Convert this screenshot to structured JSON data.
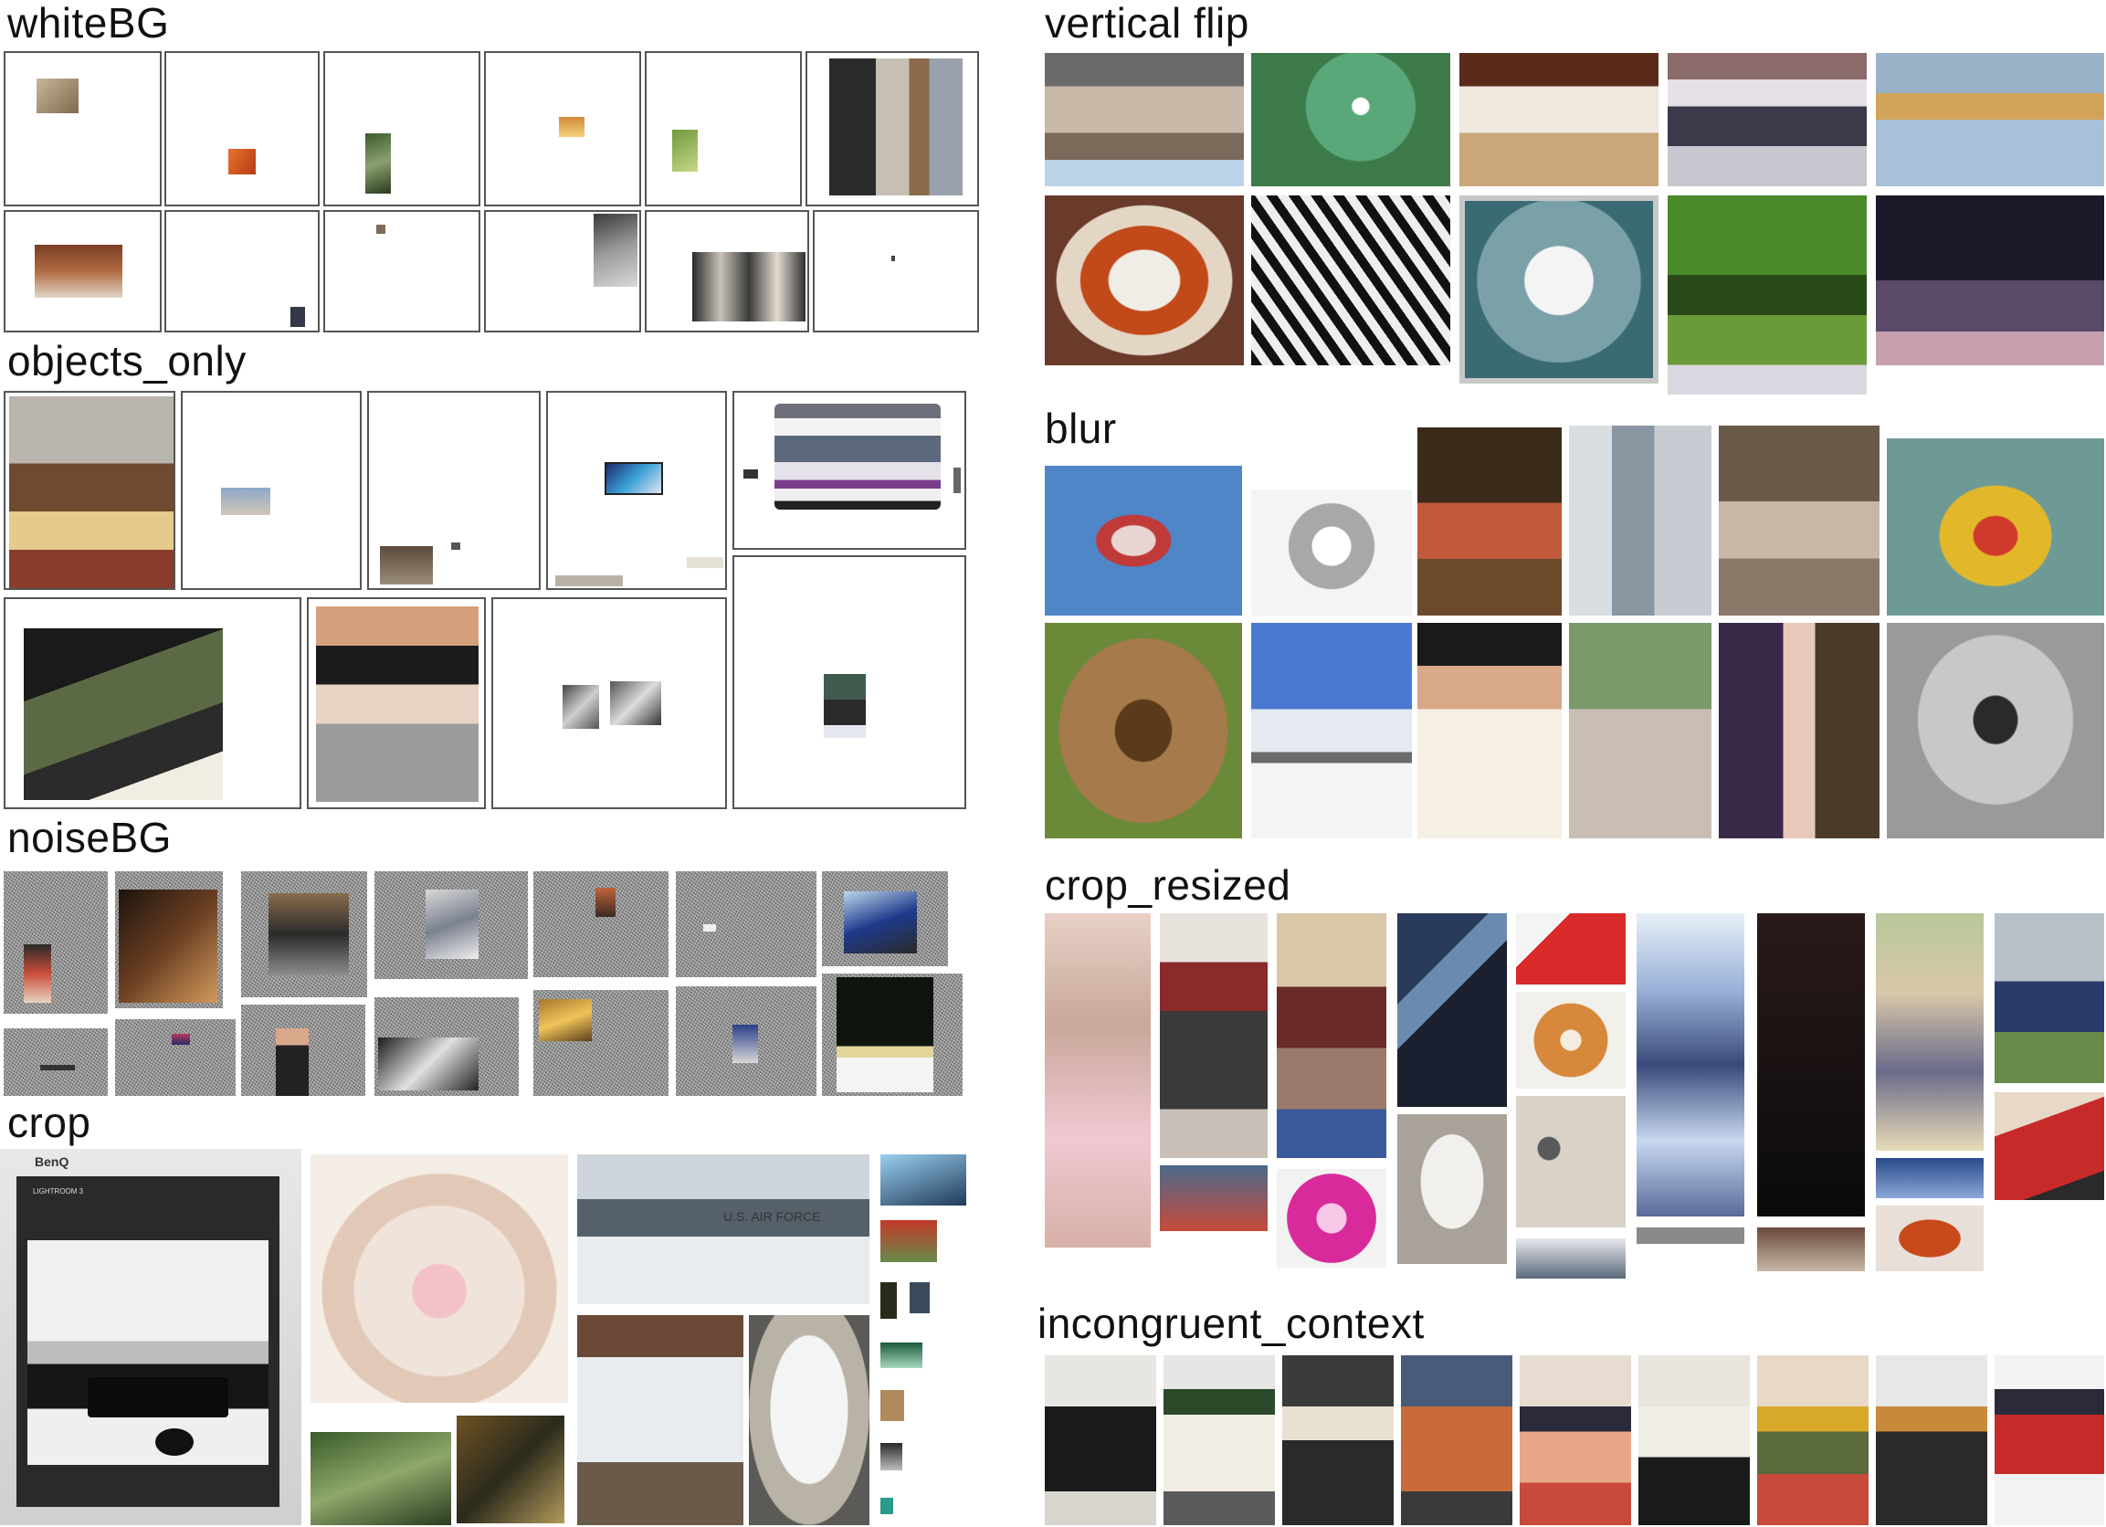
{
  "sections": {
    "whiteBG": "whiteBG",
    "objects_only": "objects_only",
    "noiseBG": "noiseBG",
    "crop": "crop",
    "vertical_flip": "vertical flip",
    "blur": "blur",
    "crop_resized": "crop_resized",
    "incongruent_context": "incongruent_context"
  },
  "crop_text": {
    "monitor_brand": "BenQ",
    "lightroom": "LIGHTROOM 3",
    "airforce": "U.S. AIR FORCE"
  },
  "colors": {
    "frame": "#555555",
    "noise": "#8a8a8a"
  }
}
